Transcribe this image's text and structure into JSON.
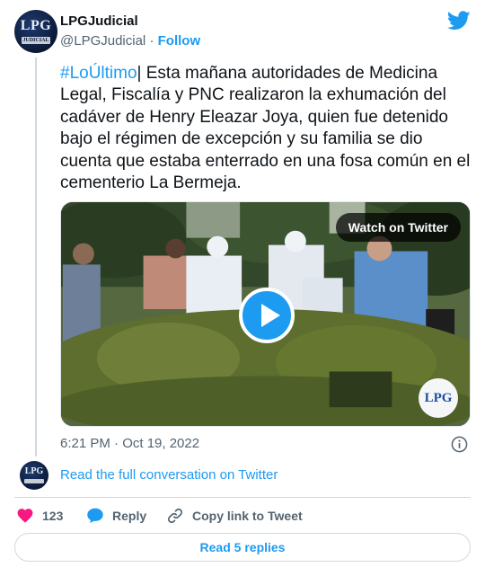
{
  "author": {
    "name": "LPGJudicial",
    "handle": "@LPGJudicial",
    "separator": " · ",
    "follow_label": "Follow",
    "avatar_text": "LPG",
    "avatar_subtext": "JUDICIAL"
  },
  "tweet": {
    "hashtag": "#LoÚltimo",
    "body": "| Esta mañana autoridades de Medicina Legal, Fiscalía y PNC realizaron la exhumación del cadáver de Henry Eleazar Joya, quien fue detenido bajo el régimen de excepción y su familia se dio cuenta que estaba enterrado en una fosa común en el cementerio La Bermeja.",
    "timestamp": "6:21 PM · Oct 19, 2022"
  },
  "media": {
    "watch_label": "Watch on Twitter",
    "watermark": "LPG"
  },
  "conversation": {
    "read_full_label": "Read the full conversation on Twitter"
  },
  "actions": {
    "like_count": "123",
    "reply_label": "Reply",
    "copy_label": "Copy link to Tweet",
    "read_replies_label": "Read 5 replies"
  },
  "icons": {
    "brand": "twitter-bird-icon",
    "info": "info-icon",
    "like": "heart-icon",
    "reply": "reply-bubble-icon",
    "copy": "link-icon",
    "play": "play-icon"
  },
  "colors": {
    "accent": "#1d9bf0",
    "heart": "#f91880",
    "text": "#0f1419",
    "muted": "#536471",
    "border": "#cfd9de"
  }
}
